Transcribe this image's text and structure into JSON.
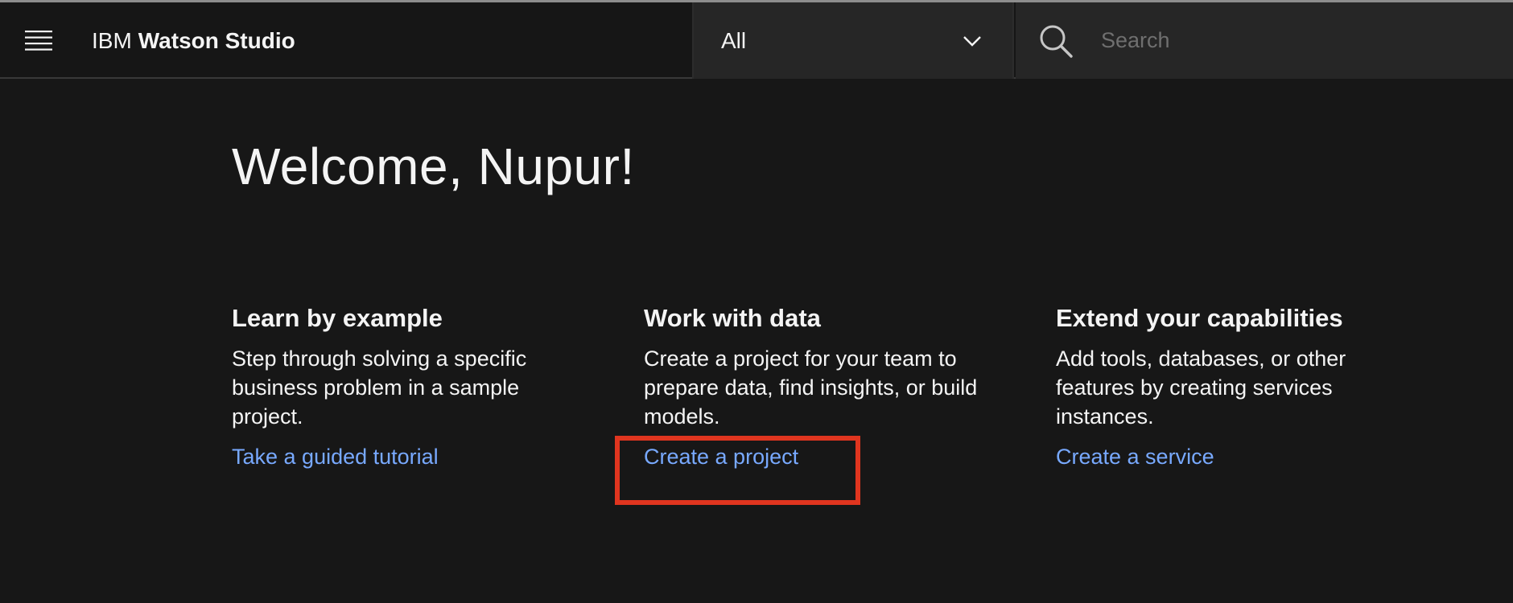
{
  "header": {
    "menu_icon": "hamburger-menu-icon",
    "brand_prefix": "IBM",
    "brand_name": "Watson Studio",
    "scope": {
      "selected": "All",
      "chevron_icon": "chevron-down-icon"
    },
    "search": {
      "icon": "search-icon",
      "placeholder": "Search"
    }
  },
  "main": {
    "welcome": "Welcome, Nupur!",
    "cards": [
      {
        "title": "Learn by example",
        "text": "Step through solving a specific business problem in a sample project.",
        "link": "Take a guided tutorial"
      },
      {
        "title": "Work with data",
        "text": "Create a project for your team to prepare data, find insights, or build models.",
        "link": "Create a project"
      },
      {
        "title": "Extend your capabilities",
        "text": "Add tools, databases, or other features by creating services instances.",
        "link": "Create a service"
      }
    ]
  },
  "annotation": {
    "highlight_color": "#e0351f"
  },
  "colors": {
    "background": "#171717",
    "header": "#161616",
    "field": "#262626",
    "text": "#f4f4f4",
    "link": "#78a9ff",
    "placeholder": "#6f6f6f"
  }
}
